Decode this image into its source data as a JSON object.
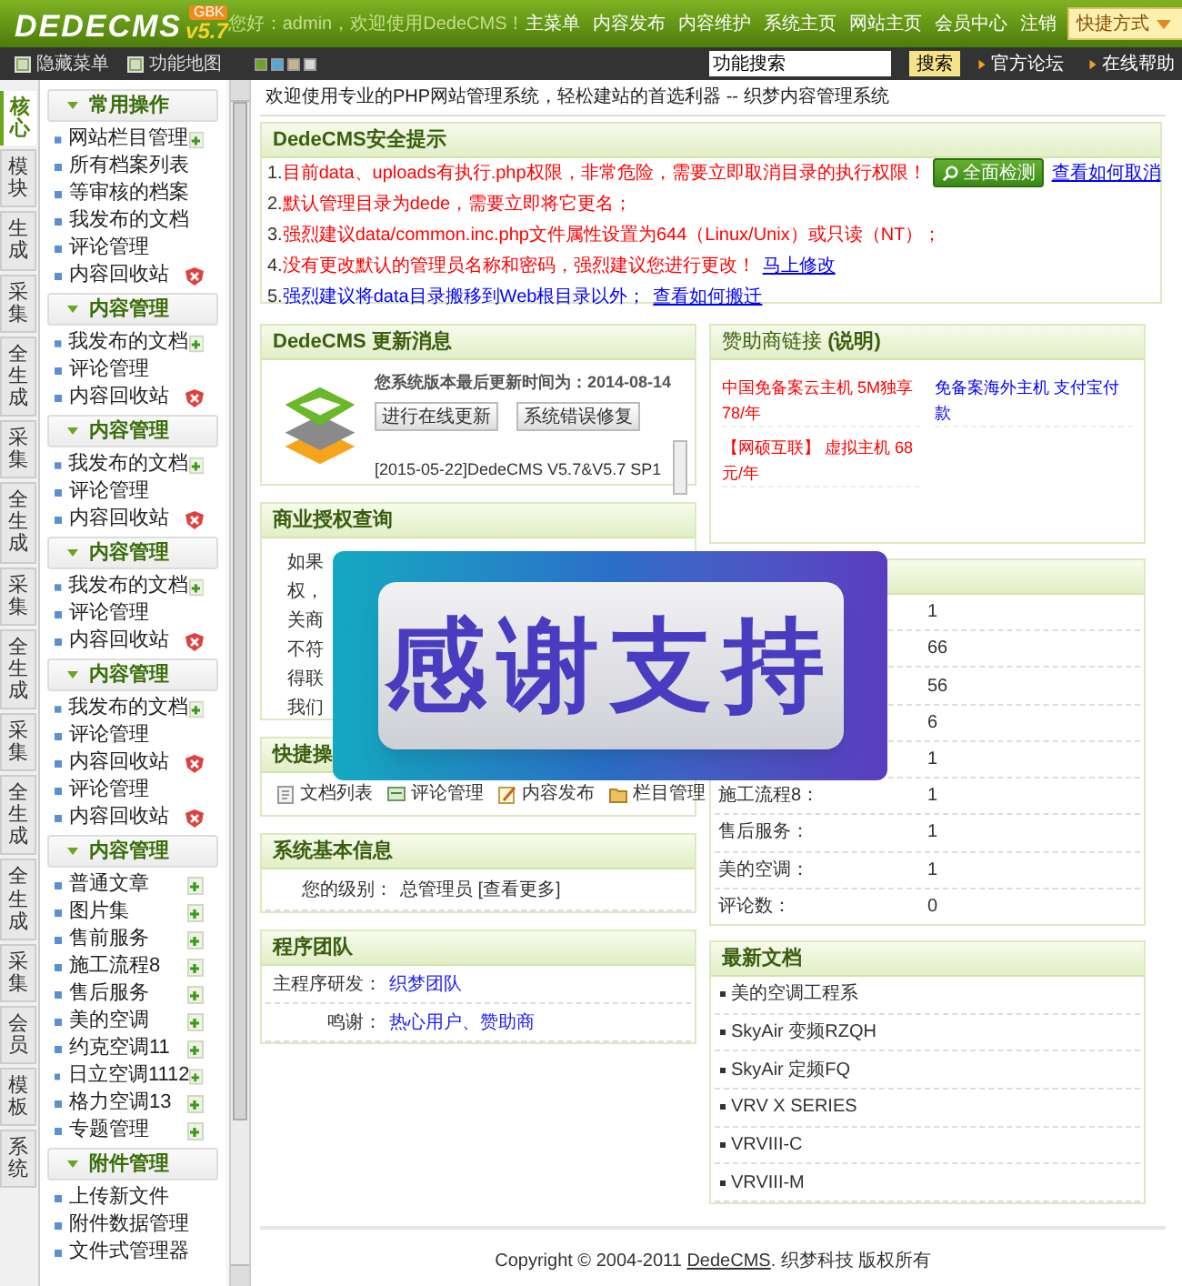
{
  "header": {
    "logo": "DEDECMS",
    "version": "v5.7",
    "edition": "GBK",
    "greeting": "您好：admin，欢迎使用DedeCMS！",
    "nav": [
      "主菜单",
      "内容发布",
      "内容维护",
      "系统主页",
      "网站主页",
      "会员中心",
      "注销"
    ],
    "shortcut": "快捷方式"
  },
  "toolbar": {
    "hide_menu": "隐藏菜单",
    "site_map": "功能地图",
    "skins": [
      {
        "color": "#6aa51c"
      },
      {
        "color": "#4fa9d8"
      },
      {
        "color": "#c8b48a"
      },
      {
        "color": "#d8d8d8"
      }
    ],
    "search": {
      "value": "功能搜索"
    },
    "search_button": "搜索",
    "links": [
      "官方论坛",
      "在线帮助"
    ]
  },
  "side_tabs": [
    {
      "label": "核心",
      "selected": true
    },
    {
      "label": "模块",
      "selected": false
    },
    {
      "label": "生成",
      "selected": false
    },
    {
      "label": "采集",
      "selected": false
    },
    {
      "label": "全生成",
      "selected": false
    },
    {
      "label": "采集",
      "selected": false
    },
    {
      "label": "全生成",
      "selected": false
    },
    {
      "label": "采集",
      "selected": false
    },
    {
      "label": "全生成",
      "selected": false
    },
    {
      "label": "采集",
      "selected": false
    },
    {
      "label": "全生成",
      "selected": false
    },
    {
      "label": "全生成",
      "selected": false
    },
    {
      "label": "采集",
      "selected": false
    },
    {
      "label": "会员",
      "selected": false
    },
    {
      "label": "模板",
      "selected": false
    },
    {
      "label": "系统",
      "selected": false
    }
  ],
  "menu_groups": [
    {
      "title": "常用操作",
      "items": [
        {
          "label": "网站栏目管理",
          "kind": "add"
        },
        {
          "label": "所有档案列表",
          "kind": "plain"
        },
        {
          "label": "等审核的档案",
          "kind": "plain"
        },
        {
          "label": "我发布的文档",
          "kind": "plain"
        },
        {
          "label": "评论管理",
          "kind": "plain"
        },
        {
          "label": "内容回收站",
          "kind": "delete"
        }
      ]
    },
    {
      "title": "内容管理",
      "items": [
        {
          "label": "我发布的文档",
          "kind": "add"
        },
        {
          "label": "评论管理",
          "kind": "plain"
        },
        {
          "label": "内容回收站",
          "kind": "delete"
        }
      ]
    },
    {
      "title": "内容管理",
      "items": [
        {
          "label": "我发布的文档",
          "kind": "add"
        },
        {
          "label": "评论管理",
          "kind": "plain"
        },
        {
          "label": "内容回收站",
          "kind": "delete"
        }
      ]
    },
    {
      "title": "内容管理",
      "items": [
        {
          "label": "我发布的文档",
          "kind": "add"
        },
        {
          "label": "评论管理",
          "kind": "plain"
        },
        {
          "label": "内容回收站",
          "kind": "delete"
        }
      ]
    },
    {
      "title": "内容管理",
      "items": [
        {
          "label": "我发布的文档",
          "kind": "add"
        },
        {
          "label": "评论管理",
          "kind": "plain"
        },
        {
          "label": "内容回收站",
          "kind": "delete"
        },
        {
          "label": "评论管理",
          "kind": "plain"
        },
        {
          "label": "内容回收站",
          "kind": "delete"
        }
      ]
    },
    {
      "title": "内容管理",
      "items": [
        {
          "label": "普通文章",
          "kind": "add"
        },
        {
          "label": "图片集",
          "kind": "add"
        },
        {
          "label": "售前服务",
          "kind": "add"
        },
        {
          "label": "施工流程8",
          "kind": "add"
        },
        {
          "label": "售后服务",
          "kind": "add"
        },
        {
          "label": "美的空调",
          "kind": "add"
        },
        {
          "label": "约克空调11",
          "kind": "add"
        },
        {
          "label": "日立空调1112",
          "kind": "add"
        },
        {
          "label": "格力空调13",
          "kind": "add"
        },
        {
          "label": "专题管理",
          "kind": "add"
        }
      ]
    },
    {
      "title": "附件管理",
      "items": [
        {
          "label": "上传新文件",
          "kind": "plain"
        },
        {
          "label": "附件数据管理",
          "kind": "plain"
        },
        {
          "label": "文件式管理器",
          "kind": "plain"
        }
      ]
    }
  ],
  "welcome": "欢迎使用专业的PHP网站管理系统，轻松建站的首选利器 -- 织梦内容管理系统",
  "security": {
    "title": "DedeCMS安全提示",
    "lines": [
      {
        "number": "1.",
        "text": "目前data、uploads有执行.php权限，非常危险，需要立即取消目录的执行权限！",
        "color": "#ff0000",
        "button": "全面检测",
        "link": "查看如何取消"
      },
      {
        "number": "2.",
        "text": "默认管理目录为dede，需要立即将它更名；",
        "color": "#ff0000"
      },
      {
        "number": "3.",
        "text": "强烈建议data/common.inc.php文件属性设置为644（Linux/Unix）或只读（NT）；",
        "color": "#ff0000"
      },
      {
        "number": "4.",
        "text": "没有更改默认的管理员名称和密码，强烈建议您进行更改！",
        "color": "#ff0000",
        "link": "马上修改"
      },
      {
        "number": "5.",
        "text": "强烈建议将data目录搬移到Web根目录以外；",
        "color": "#0000ff",
        "link": "查看如何搬迁"
      }
    ]
  },
  "update": {
    "title": "DedeCMS 更新消息",
    "notice": "您系统版本最后更新时间为：2014-08-14",
    "buttons": [
      "进行在线更新",
      "系统错误修复"
    ],
    "news": "[2015-05-22]DedeCMS V5.7&V5.7 SP1"
  },
  "sponsor": {
    "title": "赞助商链接 **(说明)**",
    "links": [
      {
        "text": "中国免备案云主机 5M独享 78/年",
        "color": "#ff0000"
      },
      {
        "text": "免备案海外主机 支付宝付款",
        "color": "#0000ff"
      },
      {
        "text": "【网硕互联】 虚拟主机 68元/年",
        "color": "#ff0000"
      }
    ]
  },
  "license": {
    "title": "商业授权查询",
    "lines": [
      "如果",
      "权，",
      "关商",
      "不符",
      "得联",
      "我们"
    ]
  },
  "stats": {
    "rows": [
      {
        "value": "1"
      },
      {
        "value": "66"
      },
      {
        "value": "56"
      },
      {
        "value": "6"
      },
      {
        "value": "1"
      },
      {
        "label": "施工流程8：",
        "value": "1"
      },
      {
        "label": "售后服务：",
        "value": "1"
      },
      {
        "label": "美的空调：",
        "value": "1"
      },
      {
        "label": "评论数：",
        "value": "0"
      }
    ]
  },
  "quick": {
    "title": "快捷操",
    "items": [
      {
        "label": "文档列表",
        "kind": "document"
      },
      {
        "label": "评论管理",
        "kind": "comment"
      },
      {
        "label": "内容发布",
        "kind": "edit"
      },
      {
        "label": "栏目管理",
        "kind": "folder"
      }
    ]
  },
  "sysinfo": {
    "title": "系统基本信息",
    "label": "您的级别：",
    "value": "总管理员 [查看更多]"
  },
  "team": {
    "title": "程序团队",
    "rows": [
      {
        "label": "主程序研发：",
        "value": "织梦团队"
      },
      {
        "label": "鸣谢：",
        "value": "热心用户、赞助商"
      }
    ]
  },
  "latest": {
    "title": "最新文档",
    "items": [
      "美的空调工程系",
      "SkyAir 变频RZQH",
      "SkyAir 定频FQ",
      "VRV X SERIES",
      "VRVIII-C",
      "VRVIII-M"
    ]
  },
  "footer": {
    "prefix": "Copyright © 2004-2011 ",
    "link": "DedeCMS",
    "suffix": ". 织梦科技 版权所有"
  },
  "overlay_banner": {
    "text": "感谢支持"
  }
}
